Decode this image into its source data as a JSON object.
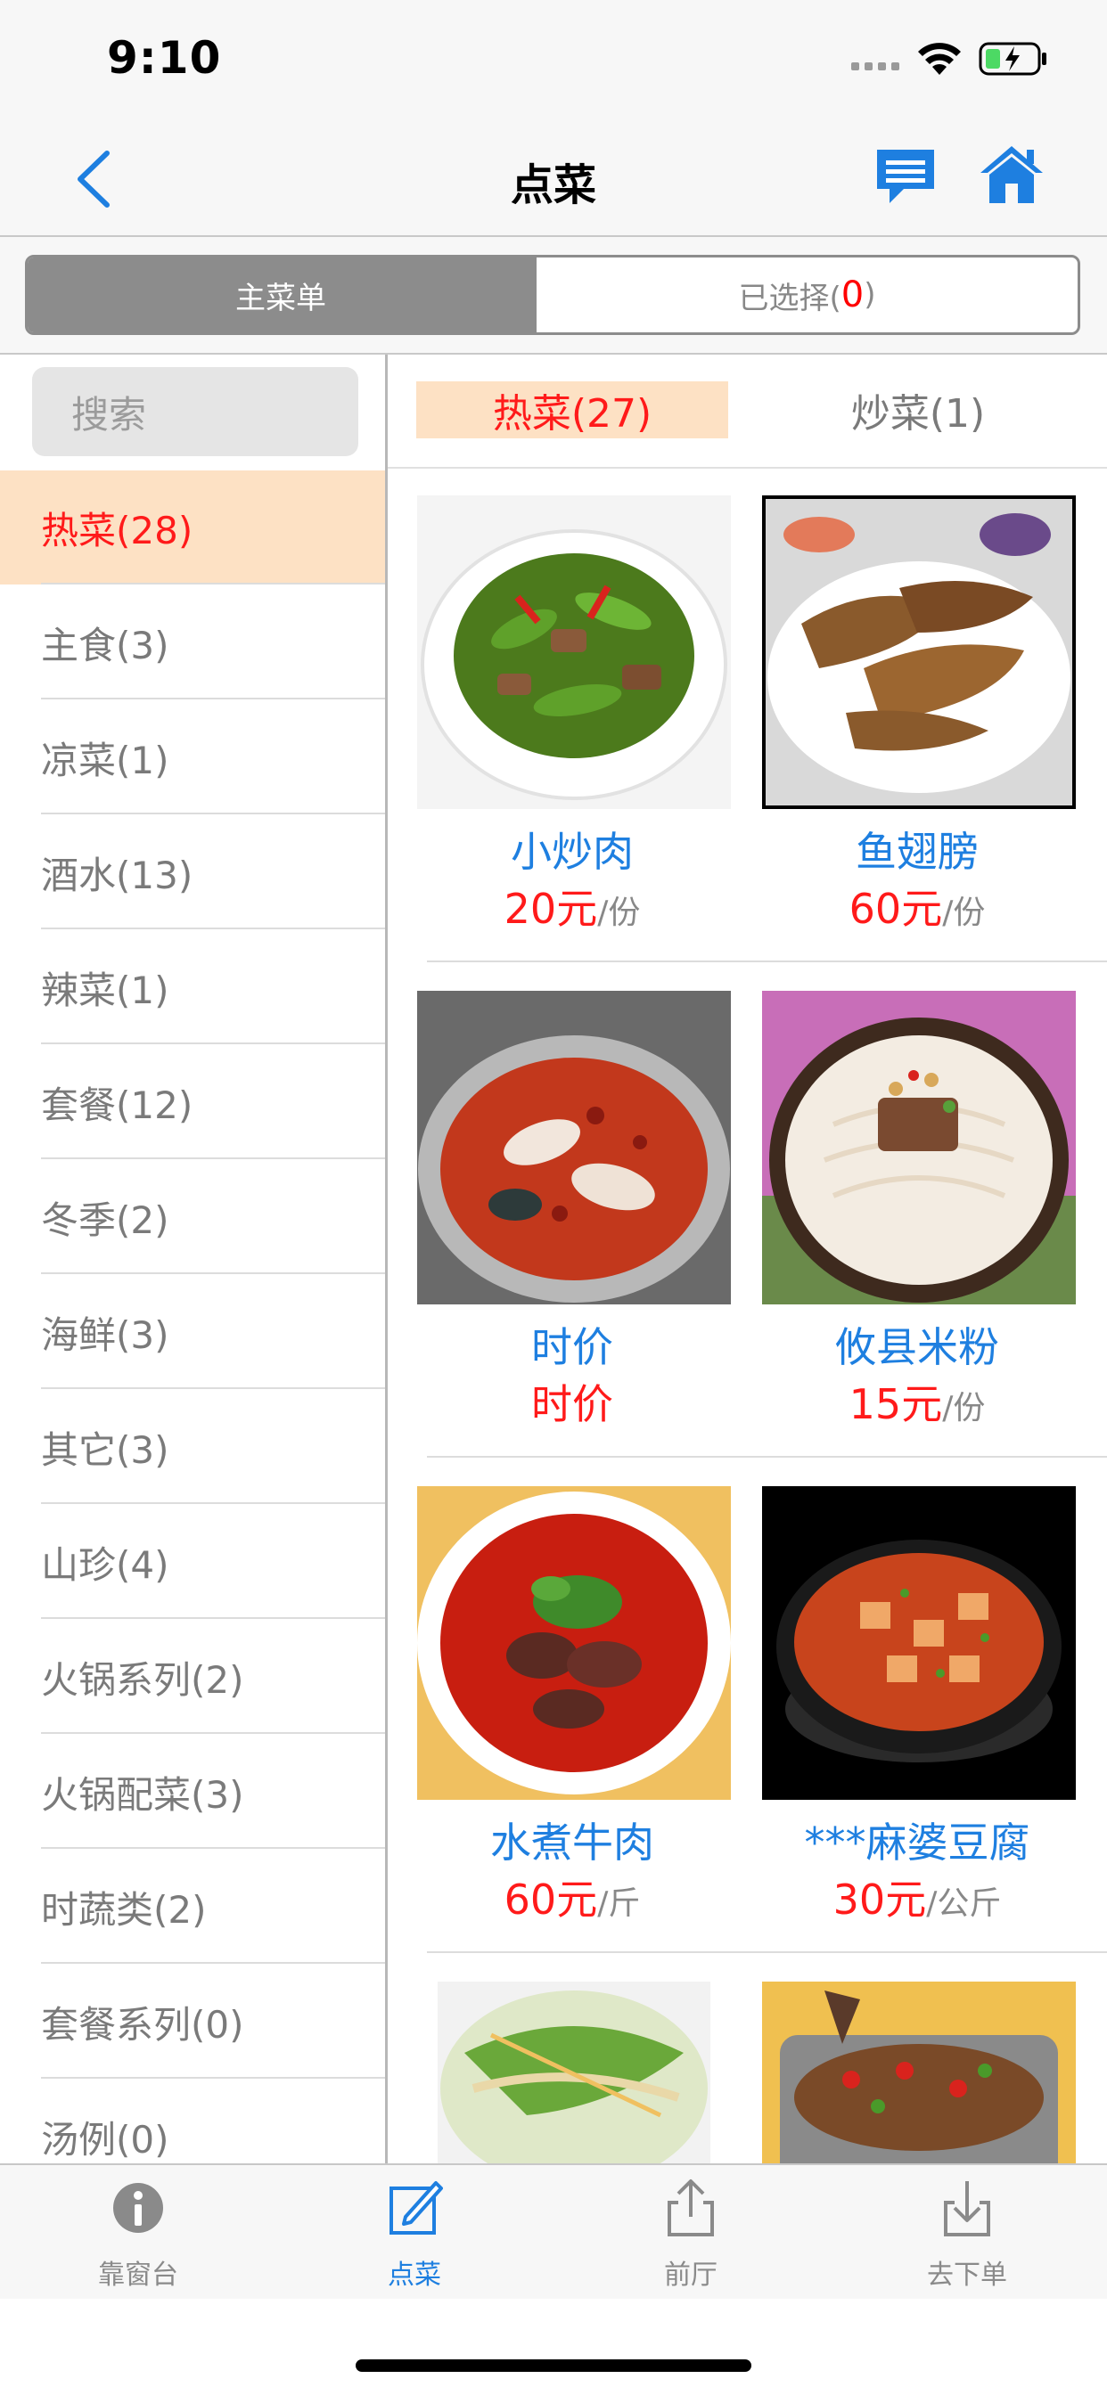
{
  "status": {
    "time": "9:10"
  },
  "nav": {
    "title": "点菜",
    "icons": [
      "chevron-left-icon",
      "message-icon",
      "home-icon"
    ]
  },
  "segment": {
    "main_label": "主菜单",
    "selected_prefix": "已选择(",
    "selected_count": "0",
    "selected_suffix": ")"
  },
  "sidebar": {
    "search_placeholder": "搜索",
    "categories": [
      {
        "label": "热菜(28)"
      },
      {
        "label": "主食(3)"
      },
      {
        "label": "凉菜(1)"
      },
      {
        "label": "酒水(13)"
      },
      {
        "label": "辣菜(1)"
      },
      {
        "label": "套餐(12)"
      },
      {
        "label": "冬季(2)"
      },
      {
        "label": "海鲜(3)"
      },
      {
        "label": "其它(3)"
      },
      {
        "label": "山珍(4)"
      },
      {
        "label": "火锅系列(2)"
      },
      {
        "label": "火锅配菜(3)"
      },
      {
        "label": "时蔬类(2)"
      },
      {
        "label": "套餐系列(0)"
      },
      {
        "label": "汤例(0)"
      }
    ],
    "active_index": 0
  },
  "subtabs": [
    {
      "label": "热菜(27)",
      "active": true
    },
    {
      "label": "炒菜(1)",
      "active": false
    }
  ],
  "dishes": [
    {
      "name": "小炒肉",
      "price": "20元",
      "unit": "/份"
    },
    {
      "name": "鱼翅膀",
      "price": "60元",
      "unit": "/份"
    },
    {
      "name": "时价",
      "price": "时价",
      "unit": ""
    },
    {
      "name": "攸县米粉",
      "price": "15元",
      "unit": "/份"
    },
    {
      "name": "水煮牛肉",
      "price": "60元",
      "unit": "/斤"
    },
    {
      "name": "***麻婆豆腐",
      "price": "30元",
      "unit": "/公斤"
    }
  ],
  "tabbar": {
    "items": [
      {
        "label": "靠窗台",
        "icon": "info-icon"
      },
      {
        "label": "点菜",
        "icon": "edit-icon"
      },
      {
        "label": "前厅",
        "icon": "share-icon"
      },
      {
        "label": "去下单",
        "icon": "download-icon"
      }
    ],
    "active_index": 1
  },
  "colors": {
    "accent": "#1e7fe0",
    "price": "#ff1a1a",
    "active_bg": "#fde1c4",
    "segment_gray": "#8c8c8c"
  }
}
